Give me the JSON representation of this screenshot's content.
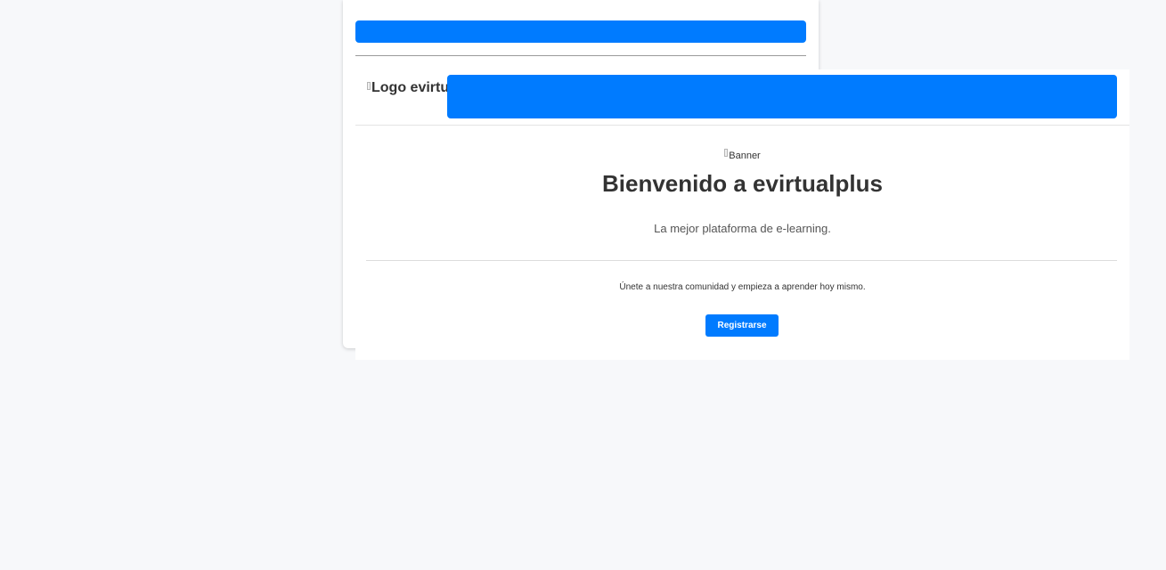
{
  "back_card": {
    "bar_color": "#007bff"
  },
  "header": {
    "logo_alt": "Logo evirtualplus",
    "nav_bar_color": "#007bff"
  },
  "hero": {
    "banner_alt": "Banner",
    "title": "Bienvenido a evirtualplus",
    "subtitle": "La mejor plataforma de e-learning."
  },
  "cta": {
    "text": "Únete a nuestra comunidad y empieza a aprender hoy mismo.",
    "button_label": "Registrarse",
    "button_color": "#007bff"
  },
  "icons": [
    "broken-image-icon"
  ]
}
